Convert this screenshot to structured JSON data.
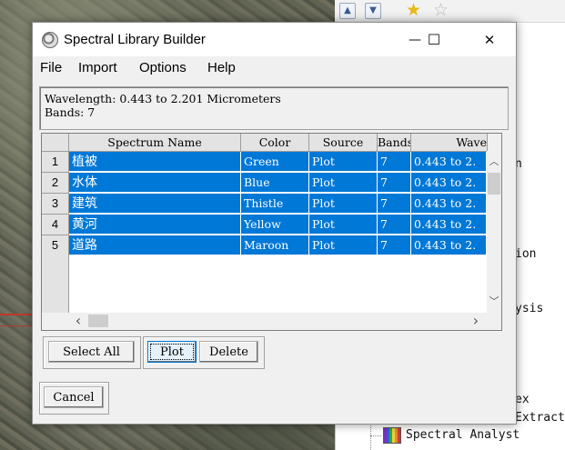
{
  "dialog": {
    "title": "Spectral Library Builder",
    "minimize_glyph": "—",
    "maximize_glyph": "☐",
    "close_glyph": "✕",
    "menu": [
      "File",
      "Import",
      "Options",
      "Help"
    ],
    "info": {
      "wavelength": "Wavelength: 0.443 to 2.201 Micrometers",
      "bands": "Bands: 7"
    },
    "table": {
      "columns": [
        "Spectrum Name",
        "Color",
        "Source",
        "Bands",
        "Wave"
      ],
      "rows": [
        {
          "num": "1",
          "name": "植被",
          "color": "Green",
          "source": "Plot",
          "bands": "7",
          "wave": "0.443 to 2."
        },
        {
          "num": "2",
          "name": "水体",
          "color": "Blue",
          "source": "Plot",
          "bands": "7",
          "wave": "0.443 to 2."
        },
        {
          "num": "3",
          "name": "建筑",
          "color": "Thistle",
          "source": "Plot",
          "bands": "7",
          "wave": "0.443 to 2."
        },
        {
          "num": "4",
          "name": "黄河",
          "color": "Yellow",
          "source": "Plot",
          "bands": "7",
          "wave": "0.443 to 2."
        },
        {
          "num": "5",
          "name": "道路",
          "color": "Maroon",
          "source": "Plot",
          "bands": "7",
          "wave": "0.443 to 2."
        }
      ],
      "scroll_up": "︿",
      "scroll_down": "﹀",
      "scroll_left": "‹",
      "scroll_right": "›"
    },
    "buttons": {
      "select_all": "Select All",
      "plot": "Plot",
      "delete": "Delete",
      "cancel": "Cancel"
    }
  },
  "background_panel": {
    "toolbar_icons": [
      "chevron-up-icon",
      "chevron-down-icon",
      "star-filled-icon",
      "star-outline-icon"
    ],
    "fragments": [
      "n",
      "ion",
      "ysis",
      "ex",
      "Extract"
    ],
    "tree_item": "Spectral Analyst"
  },
  "colors": {
    "selection": "#0078d7",
    "window_bg": "#f0f0f0",
    "header_bg": "#e3e3e3"
  }
}
